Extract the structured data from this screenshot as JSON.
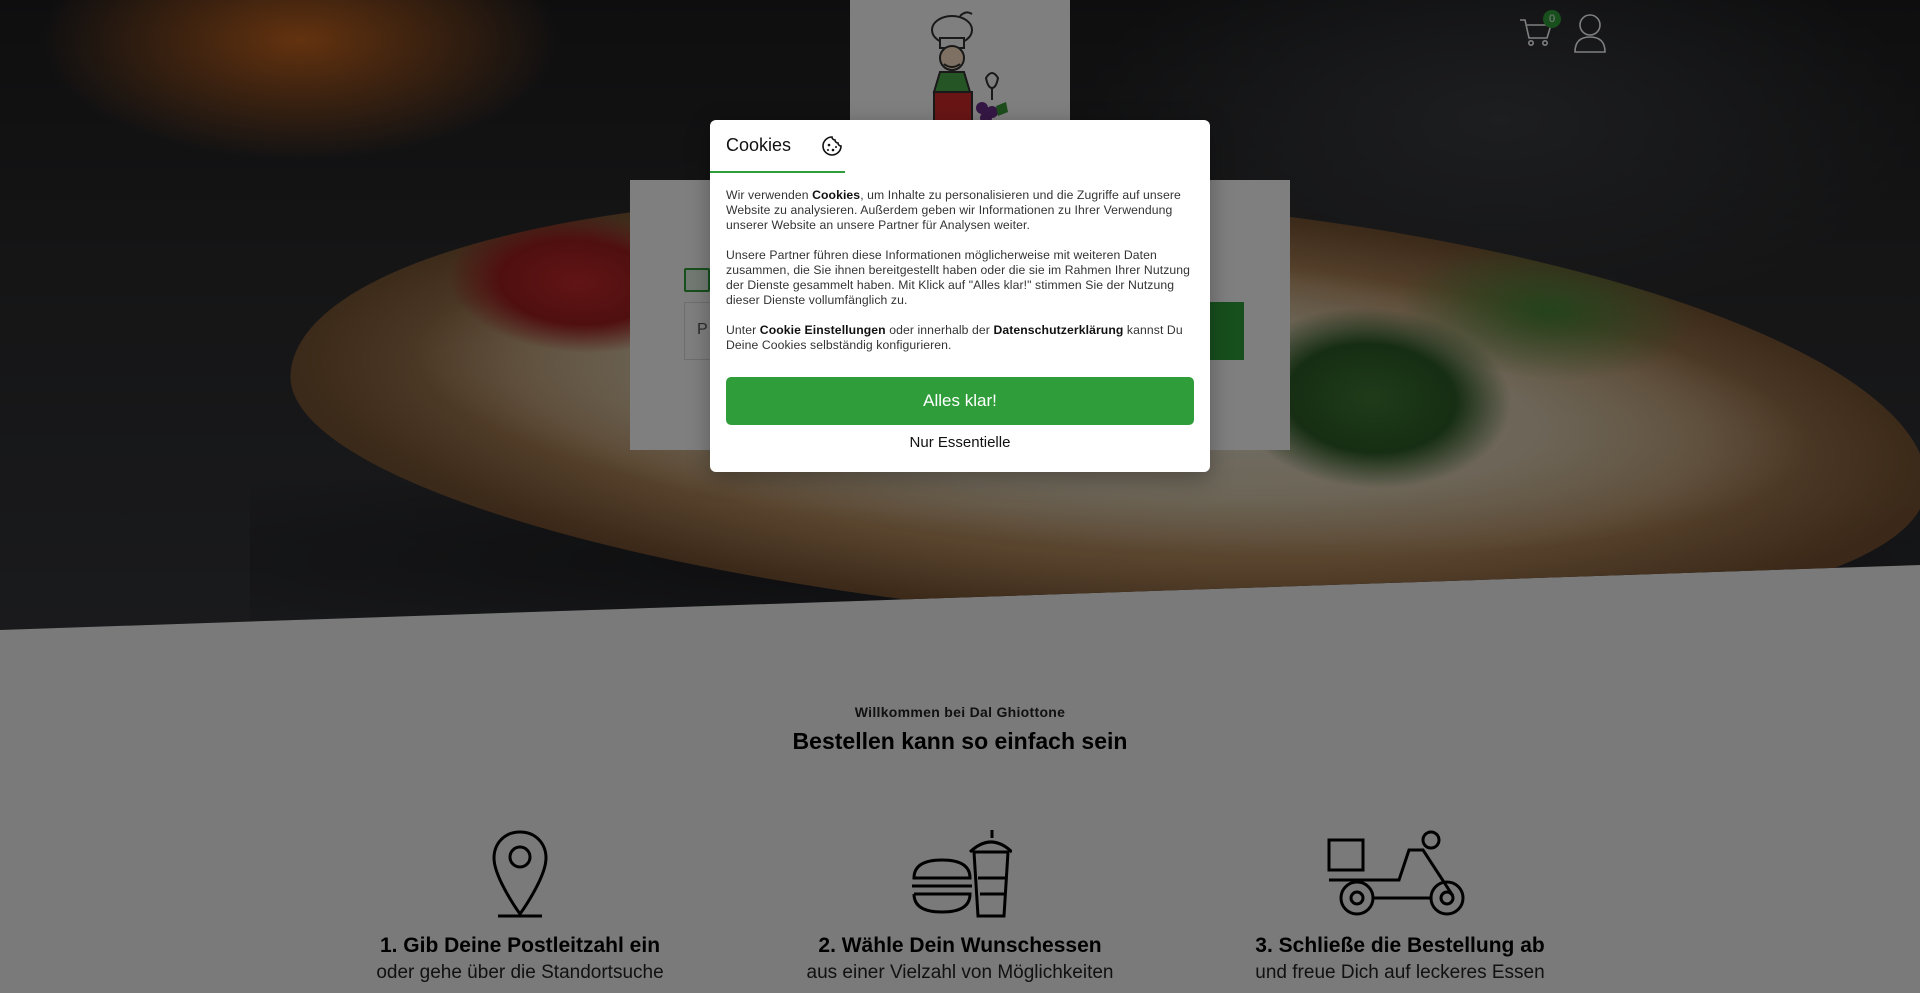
{
  "header": {
    "cart_count": "0"
  },
  "search_card": {
    "input_placeholder": "P"
  },
  "intro": {
    "kicker": "Willkommen bei Dal Ghiottone",
    "title": "Bestellen kann so einfach sein"
  },
  "steps": [
    {
      "title": "1. Gib Deine Postleitzahl ein",
      "subtitle": "oder gehe über die Standortsuche",
      "icon": "location-pin-icon"
    },
    {
      "title": "2. Wähle Dein Wunschessen",
      "subtitle": "aus einer Vielzahl von Möglichkeiten",
      "icon": "burger-drink-icon"
    },
    {
      "title": "3. Schließe die Bestellung ab",
      "subtitle": "und freue Dich auf leckeres Essen",
      "icon": "delivery-scooter-icon"
    }
  ],
  "cookie_modal": {
    "tab_label": "Cookies",
    "p1_before": "Wir verwenden ",
    "p1_bold": "Cookies",
    "p1_after": ", um Inhalte zu personalisieren und die Zugriffe auf unsere Website zu analysieren. Außerdem geben wir Informationen zu Ihrer Verwendung unserer Website an unsere Partner für Analysen weiter.",
    "p2": "Unsere Partner führen diese Informationen möglicherweise mit weiteren Daten zusammen, die Sie ihnen bereitgestellt haben oder die sie im Rahmen Ihrer Nutzung der Dienste gesammelt haben. Mit Klick auf \"Alles klar!\" stimmen Sie der Nutzung dieser Dienste vollumfänglich zu.",
    "p3_before": "Unter ",
    "p3_link1": "Cookie Einstellungen",
    "p3_middle": " oder innerhalb der ",
    "p3_link2": "Datenschutzerklärung",
    "p3_after": " kannst Du Deine Cookies selbständig konfigurieren.",
    "accept_label": "Alles klar!",
    "essential_label": "Nur Essentielle"
  },
  "colors": {
    "accent": "#2f9e3a",
    "overlay": "rgba(0,0,0,0.5)"
  }
}
